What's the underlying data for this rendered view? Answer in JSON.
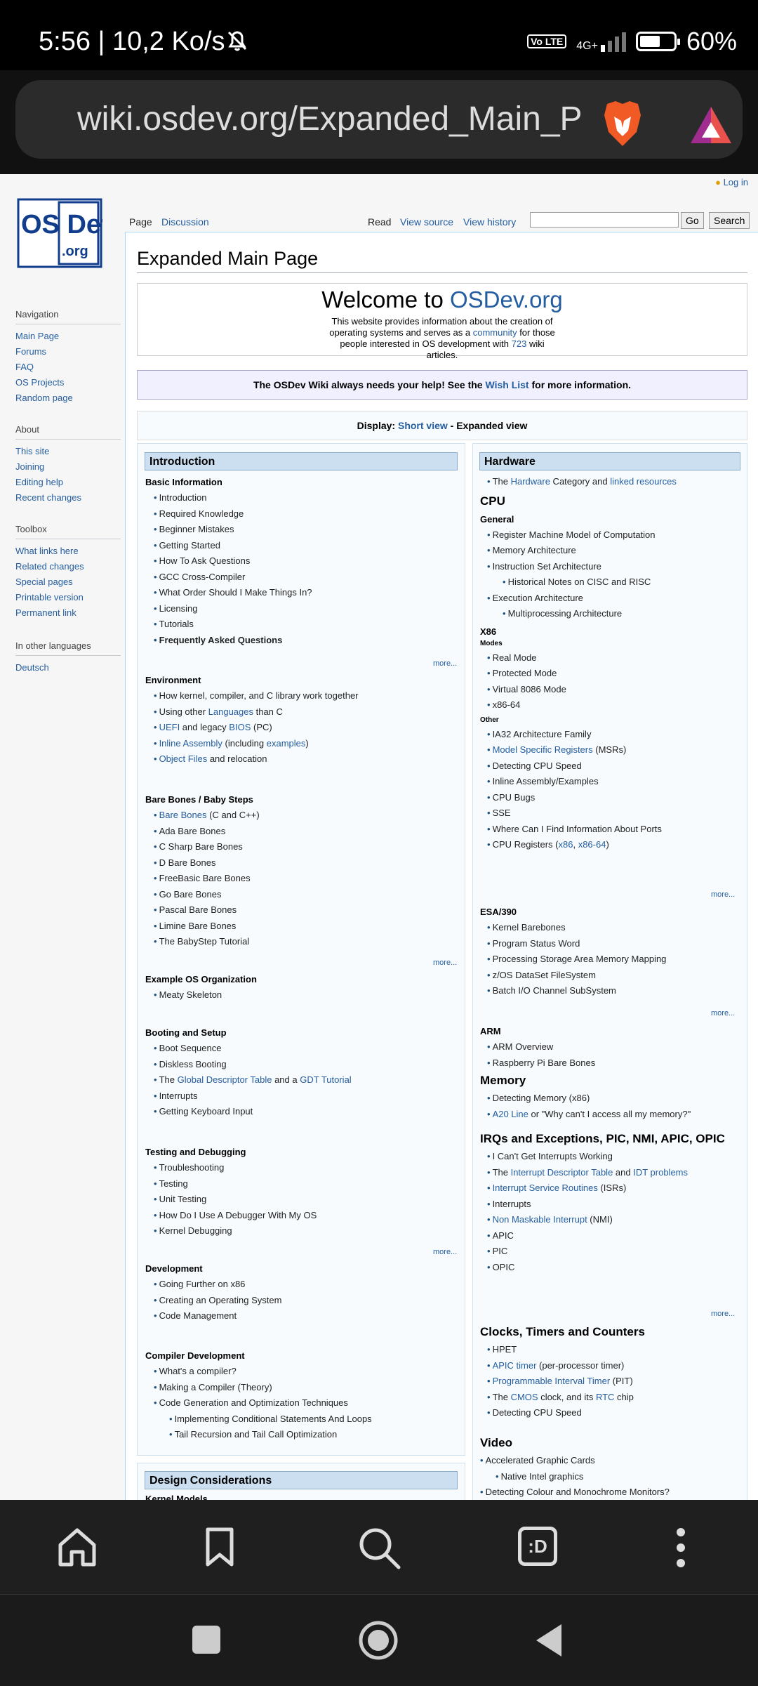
{
  "status": {
    "time": "5:56 | 10,2 Ko/s",
    "volte": "Vo LTE",
    "network": "4G+",
    "battery": "60%",
    "battery_level": 0.6
  },
  "url_bar": {
    "url": "wiki.osdev.org/Expanded_Main_Pag"
  },
  "header": {
    "login": "Log in",
    "logo_line1": "OS Dev",
    "logo_line2": ".org"
  },
  "tabs": {
    "page": "Page",
    "discussion": "Discussion",
    "read": "Read",
    "view_source": "View source",
    "view_history": "View history",
    "go": "Go",
    "search": "Search"
  },
  "sidebar": {
    "navigation": {
      "title": "Navigation",
      "items": [
        "Main Page",
        "Forums",
        "FAQ",
        "OS Projects",
        "Random page"
      ]
    },
    "about": {
      "title": "About",
      "items": [
        "This site",
        "Joining",
        "Editing help",
        "Recent changes"
      ]
    },
    "toolbox": {
      "title": "Toolbox",
      "items": [
        "What links here",
        "Related changes",
        "Special pages",
        "Printable version",
        "Permanent link"
      ]
    },
    "languages": {
      "title": "In other languages",
      "items": [
        "Deutsch"
      ]
    }
  },
  "page_title": "Expanded Main Page",
  "welcome": {
    "prefix": "Welcome to ",
    "site": "OSDev.org",
    "d1": "This website provides information about the creation of operating systems and serves as a ",
    "community": "community",
    "d2": " for those people interested in OS development with ",
    "count": "723",
    "d3": " wiki articles."
  },
  "help_banner": {
    "t1": "The OSDev Wiki always needs your help! See the ",
    "link": "Wish List",
    "t2": " for more information."
  },
  "display": {
    "label": "Display: ",
    "short": "Short view",
    "sep": " - Expanded view"
  },
  "intro": {
    "title": "Introduction",
    "basic": {
      "title": "Basic Information",
      "items": [
        "Introduction",
        "Required Knowledge",
        "Beginner Mistakes",
        "Getting Started",
        "How To Ask Questions",
        "GCC Cross-Compiler",
        "What Order Should I Make Things In?",
        "Licensing",
        "Tutorials",
        "Frequently Asked Questions"
      ]
    },
    "more": "more...",
    "env": {
      "title": "Environment",
      "i1": "How kernel, compiler, and C library work together",
      "i2a": "Using other ",
      "i2b": "Languages",
      "i2c": " than C",
      "i3a": "UEFI",
      "i3b": " and legacy ",
      "i3c": "BIOS",
      "i3d": " (PC)",
      "i4a": "Inline Assembly",
      "i4b": " (including ",
      "i4c": "examples",
      "i4d": ")",
      "i5a": "Object Files",
      "i5b": " and relocation"
    },
    "bare": {
      "title": "Bare Bones / Baby Steps",
      "i1a": "Bare Bones",
      "i1b": " (C and C++)",
      "items": [
        "Ada Bare Bones",
        "C Sharp Bare Bones",
        "D Bare Bones",
        "FreeBasic Bare Bones",
        "Go Bare Bones",
        "Pascal Bare Bones",
        "Limine Bare Bones",
        "The BabyStep Tutorial"
      ]
    },
    "example": {
      "title": "Example OS Organization",
      "items": [
        "Meaty Skeleton"
      ]
    },
    "boot": {
      "title": "Booting and Setup",
      "i1": "Boot Sequence",
      "i2": "Diskless Booting",
      "i3a": "The ",
      "i3b": "Global Descriptor Table",
      "i3c": " and a ",
      "i3d": "GDT Tutorial",
      "i4": "Interrupts",
      "i5": "Getting Keyboard Input"
    },
    "test": {
      "title": "Testing and Debugging",
      "items": [
        "Troubleshooting",
        "Testing",
        "Unit Testing",
        "How Do I Use A Debugger With My OS",
        "Kernel Debugging"
      ]
    },
    "dev": {
      "title": "Development",
      "items": [
        "Going Further on x86",
        "Creating an Operating System",
        "Code Management"
      ]
    },
    "compiler": {
      "title": "Compiler Development",
      "i1": "What's a compiler?",
      "i2": "Making a Compiler (Theory)",
      "i3": "Code Generation and Optimization Techniques",
      "s1": "Implementing Conditional Statements And Loops",
      "s2": "Tail Recursion and Tail Call Optimization"
    },
    "design": "Design Considerations",
    "design_next": "Kernel Models"
  },
  "hw": {
    "title": "Hardware",
    "h1a": "The ",
    "h1b": "Hardware",
    "h1c": " Category and ",
    "h1d": "linked resources",
    "cpu": "CPU",
    "general": {
      "title": "General",
      "i1": "Register Machine Model of Computation",
      "i2": "Memory Architecture",
      "i3": "Instruction Set Architecture",
      "s1": "Historical Notes on CISC and RISC",
      "i4": "Execution Architecture",
      "s2": "Multiprocessing Architecture"
    },
    "x86": "X86",
    "modes": {
      "title": "Modes",
      "items": [
        "Real Mode",
        "Protected Mode",
        "Virtual 8086 Mode",
        "x86-64"
      ]
    },
    "other": {
      "title": "Other",
      "i1": "IA32 Architecture Family",
      "i2a": "Model Specific Registers",
      "i2b": " (MSRs)",
      "i3": "Detecting CPU Speed",
      "i4": "Inline Assembly/Examples",
      "i5": "CPU Bugs",
      "i6": "SSE",
      "i7": "Where Can I Find Information About Ports",
      "i8a": "CPU Registers (",
      "i8b": "x86",
      "i8c": ", ",
      "i8d": "x86-64",
      "i8e": ")"
    },
    "more": "more...",
    "esa": {
      "title": "ESA/390",
      "items": [
        "Kernel Barebones",
        "Program Status Word",
        "Processing Storage Area Memory Mapping",
        "z/OS DataSet FileSystem",
        "Batch I/O Channel SubSystem"
      ]
    },
    "arm": {
      "title": "ARM",
      "items": [
        "ARM Overview",
        "Raspberry Pi Bare Bones"
      ]
    },
    "memory": {
      "title": "Memory",
      "i1": "Detecting Memory (x86)",
      "i2a": "A20 Line",
      "i2b": " or \"Why can't I access all my memory?\""
    },
    "irq": {
      "title": "IRQs and Exceptions, PIC, NMI, APIC, OPIC",
      "i1": "I Can't Get Interrupts Working",
      "i2a": "The ",
      "i2b": "Interrupt Descriptor Table",
      "i2c": " and ",
      "i2d": "IDT problems",
      "i3a": "Interrupt Service Routines",
      "i3b": " (ISRs)",
      "i4": "Interrupts",
      "i5a": "Non Maskable Interrupt",
      "i5b": " (NMI)",
      "i6": "APIC",
      "i7": "PIC",
      "i8": "OPIC"
    },
    "clocks": {
      "title": "Clocks, Timers and Counters",
      "i1": "HPET",
      "i2a": "APIC timer",
      "i2b": " (per-processor timer)",
      "i3a": "Programmable Interval Timer",
      "i3b": " (PIT)",
      "i4a": "The ",
      "i4b": "CMOS",
      "i4c": " clock, and its ",
      "i4d": "RTC",
      "i4e": " chip",
      "i5": "Detecting CPU Speed"
    },
    "video": {
      "title": "Video",
      "i1": "Accelerated Graphic Cards",
      "s1": "Native Intel graphics",
      "i2": "Detecting Colour and Monochrome Monitors?"
    }
  },
  "nav": {
    "home": "home-icon",
    "bookmarks": "bookmark-icon",
    "search": "search-icon",
    "tabs_label": ":D",
    "menu": "more-icon"
  }
}
